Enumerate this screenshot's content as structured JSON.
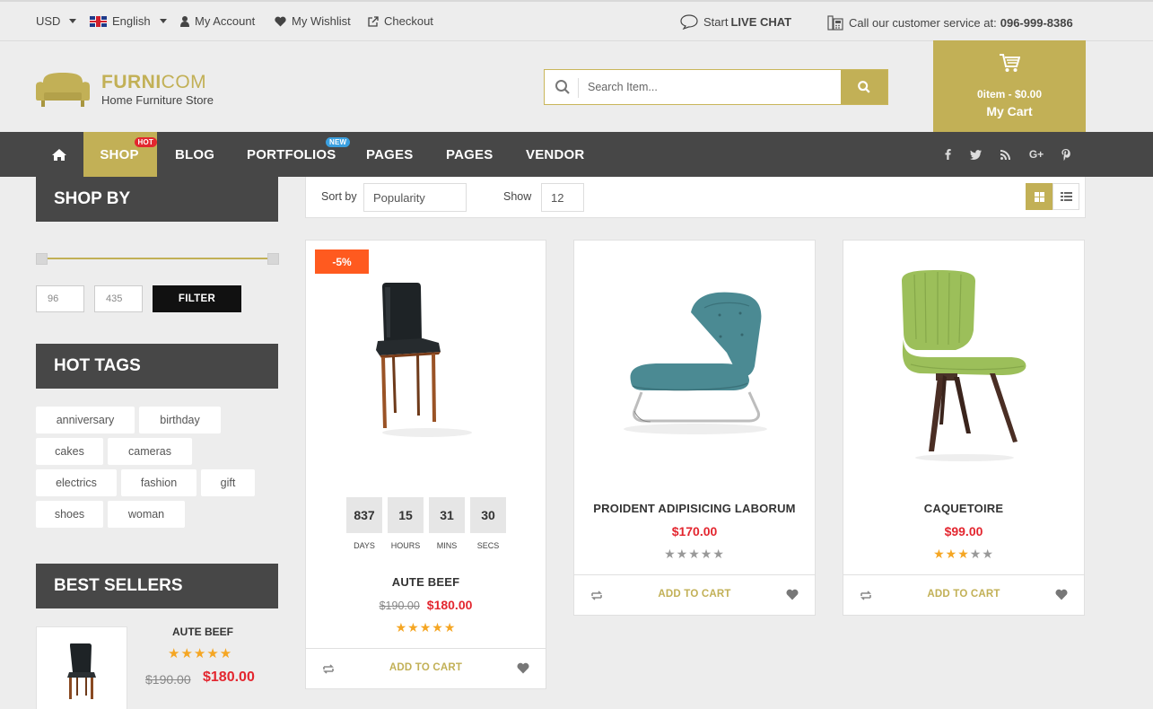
{
  "topbar": {
    "currency": "USD",
    "language": "English",
    "my_account": "My Account",
    "wishlist": "My Wishlist",
    "checkout": "Checkout",
    "live_chat_prefix": "Start",
    "live_chat": "LIVE CHAT",
    "service_text": "Call our customer service at:",
    "phone": "096-999-8386"
  },
  "header": {
    "brand_bold": "FURNI",
    "brand_light": "COM",
    "tagline": "Home Furniture Store",
    "search_placeholder": "Search Item...",
    "cart_count": "0item - $0.00",
    "cart_title": "My Cart"
  },
  "nav": {
    "items": [
      "SHOP",
      "BLOG",
      "PORTFOLIOS",
      "PAGES",
      "PAGES",
      "VENDOR"
    ],
    "badge_hot": "HOT",
    "badge_new": "NEW"
  },
  "sidebar": {
    "shop_by": "SHOP BY",
    "price_min": "96",
    "price_max": "435",
    "filter_label": "FILTER",
    "hot_tags_title": "HOT TAGS",
    "tags": [
      "anniversary",
      "birthday",
      "cakes",
      "cameras",
      "electrics",
      "fashion",
      "gift",
      "shoes",
      "woman"
    ],
    "best_sellers_title": "BEST SELLERS",
    "best_seller": {
      "name": "AUTE BEEF",
      "old_price": "$190.00",
      "price": "$180.00",
      "rating": 5
    }
  },
  "toolbar": {
    "sort_label": "Sort by",
    "sort_value": "Popularity",
    "show_label": "Show",
    "show_value": "12"
  },
  "products": [
    {
      "name": "AUTE BEEF",
      "old_price": "$190.00",
      "price": "$180.00",
      "rating": 5,
      "sale_badge": "-5%",
      "countdown": {
        "days": "837",
        "hours": "15",
        "mins": "31",
        "secs": "30"
      },
      "countdown_labels": {
        "days": "DAYS",
        "hours": "HOURS",
        "mins": "MINS",
        "secs": "SECS"
      },
      "add_to_cart": "ADD TO CART",
      "chair_color": "#1e2326"
    },
    {
      "name": "PROIDENT ADIPISICING LABORUM",
      "price": "$170.00",
      "rating": 0,
      "add_to_cart": "ADD TO CART",
      "chair_color": "#4b8a93"
    },
    {
      "name": "CAQUETOIRE",
      "price": "$99.00",
      "rating": 3,
      "add_to_cart": "ADD TO CART",
      "chair_color": "#9cbf5a"
    }
  ],
  "colors": {
    "accent": "#c2b056",
    "dark": "#474747",
    "price_red": "#e3262f",
    "sale_orange": "#ff5a1f"
  }
}
